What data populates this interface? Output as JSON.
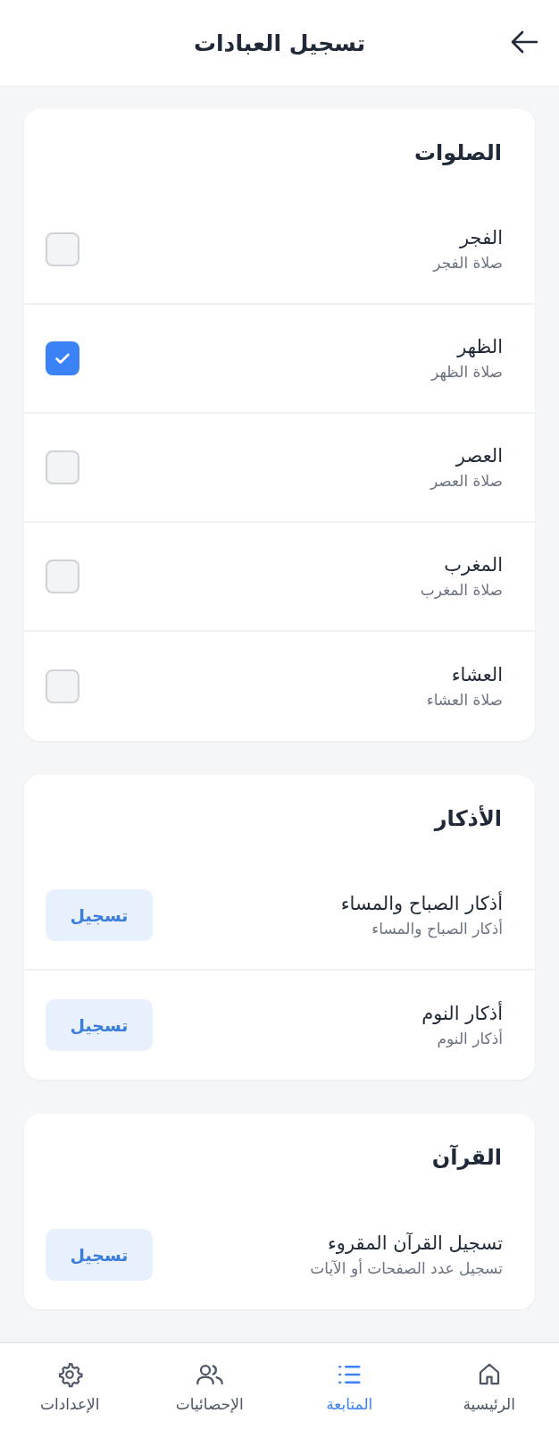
{
  "header": {
    "title": "تسجيل العبادات"
  },
  "sections": [
    {
      "title": "الصلوات",
      "items": [
        {
          "kind": "checkbox",
          "title": "الفجر",
          "subtitle": "صلاة الفجر",
          "checked": false
        },
        {
          "kind": "checkbox",
          "title": "الظهر",
          "subtitle": "صلاة الظهر",
          "checked": true
        },
        {
          "kind": "checkbox",
          "title": "العصر",
          "subtitle": "صلاة العصر",
          "checked": false
        },
        {
          "kind": "checkbox",
          "title": "المغرب",
          "subtitle": "صلاة المغرب",
          "checked": false
        },
        {
          "kind": "checkbox",
          "title": "العشاء",
          "subtitle": "صلاة العشاء",
          "checked": false
        }
      ]
    },
    {
      "title": "الأذكار",
      "items": [
        {
          "kind": "button",
          "title": "أذكار الصباح والمساء",
          "subtitle": "أذكار الصباح والمساء",
          "button": "تسجيل"
        },
        {
          "kind": "button",
          "title": "أذكار النوم",
          "subtitle": "أذكار النوم",
          "button": "تسجيل"
        }
      ]
    },
    {
      "title": "القرآن",
      "items": [
        {
          "kind": "button",
          "title": "تسجيل القرآن المقروء",
          "subtitle": "تسجيل عدد الصفحات أو الآيات",
          "button": "تسجيل"
        }
      ]
    }
  ],
  "nav": [
    {
      "kind": "home",
      "label": "الرئيسية",
      "selected": false
    },
    {
      "kind": "list",
      "label": "المتابعة",
      "selected": true
    },
    {
      "kind": "people",
      "label": "الإحصائيات",
      "selected": false
    },
    {
      "kind": "gear",
      "label": "الإعدادات",
      "selected": false
    }
  ]
}
